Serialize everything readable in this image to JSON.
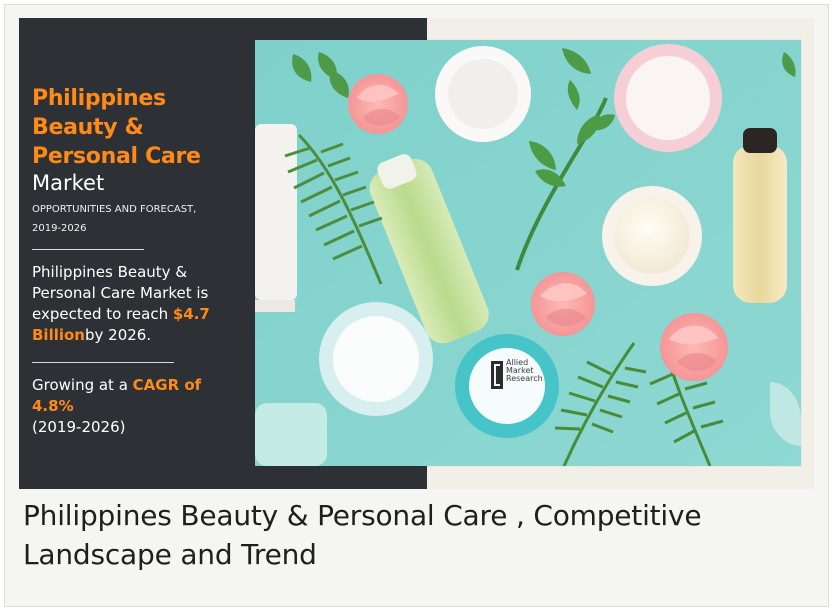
{
  "hero": {
    "title_orange": [
      "Philippines",
      "Beauty &",
      "Personal Care"
    ],
    "title_white": "Market",
    "subtitle_lines": [
      "OPPORTUNITIES AND FORECAST,",
      "2019-2026"
    ],
    "body_lines": {
      "line1": "Philippines Beauty &",
      "line2": "Personal Care Market is",
      "line3_prefix": "expected to reach ",
      "line3_accent": "$4.7",
      "line4_accent": "Billion",
      "line4_suffix": "by 2026."
    },
    "growth": {
      "prefix": "Growing at a ",
      "accent": "CAGR of 4.8%",
      "years": "(2019-2026)"
    }
  },
  "logo": {
    "lines": [
      "Allied",
      "Market",
      "Research"
    ]
  },
  "caption": {
    "line1": "Philippines Beauty & Personal Care , Competitive",
    "line2": "Landscape and Trend"
  },
  "colors": {
    "accent": "#ff8a1a",
    "panel": "#2d3135",
    "photo_bg": "#87d4cf"
  }
}
